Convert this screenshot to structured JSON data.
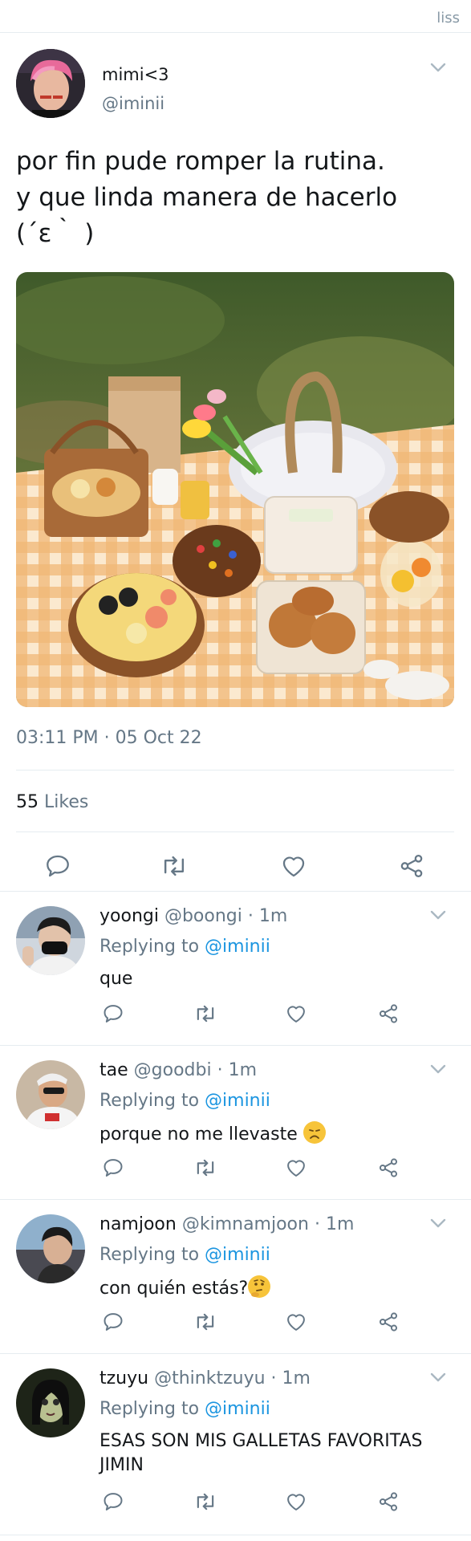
{
  "watermark": "liss",
  "tweet": {
    "name": "mimi<3",
    "handle": "@iminii",
    "text_lines": [
      "por fin pude romper la rutina.",
      "y que linda manera de hacerlo",
      "(´ε｀ )"
    ],
    "timestamp": "03:11 PM · 05 Oct 22",
    "likes_count": "55",
    "likes_label": "Likes"
  },
  "replies": [
    {
      "name": "yoongi",
      "handle": "@boongi",
      "time": "1m",
      "replying_label": "Replying to",
      "replying_to": "@iminii",
      "text": "que"
    },
    {
      "name": "tae",
      "handle": "@goodbi",
      "time": "1m",
      "replying_label": "Replying to",
      "replying_to": "@iminii",
      "text": "porque no me llevaste",
      "emoji": "disappointed-face"
    },
    {
      "name": "namjoon",
      "handle": "@kimnamjoon",
      "time": "1m",
      "replying_label": "Replying to",
      "replying_to": "@iminii",
      "text": "con quién estás?",
      "emoji": "thinking-face"
    },
    {
      "name": "tzuyu",
      "handle": "@thinktzuyu",
      "time": "1m",
      "replying_label": "Replying to",
      "replying_to": "@iminii",
      "text": "ESAS SON MIS GALLETAS FAVORITAS JIMIN"
    }
  ],
  "photo_label": "Picnic",
  "icons": {
    "reply": "reply-icon",
    "retweet": "retweet-icon",
    "like": "heart-icon",
    "share": "share-icon",
    "menu": "chevron-down-icon"
  },
  "colors": {
    "link": "#1b95e0",
    "secondary": "#657786",
    "divider": "#e6ecf0"
  }
}
